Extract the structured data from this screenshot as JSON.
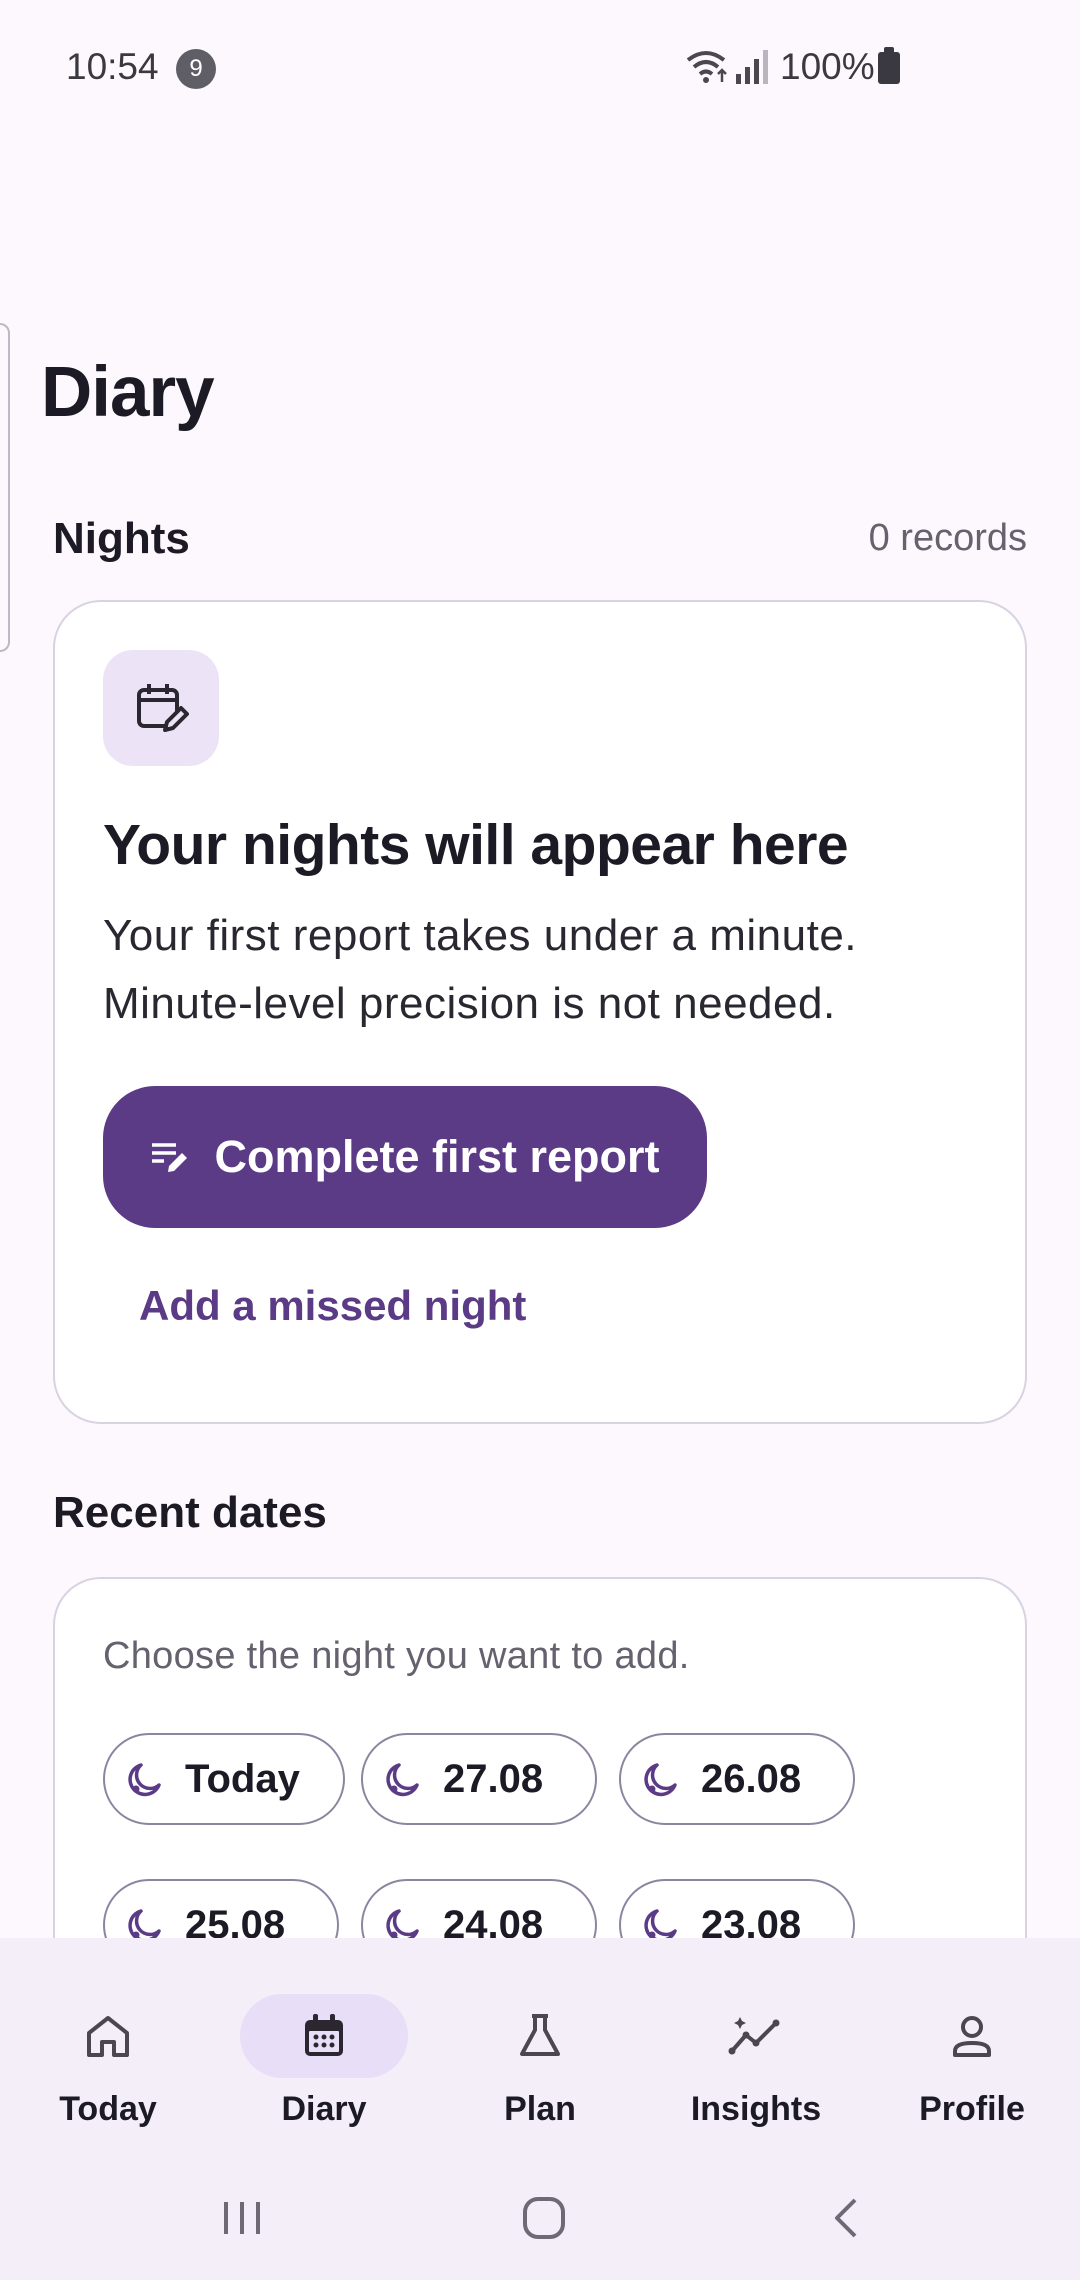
{
  "status_bar": {
    "time": "10:54",
    "notification_count": "9",
    "battery": "100%",
    "icons": [
      "wifi-icon",
      "signal-icon",
      "battery-icon"
    ]
  },
  "page": {
    "title": "Diary"
  },
  "nights": {
    "section_title": "Nights",
    "count": "0 records",
    "empty_state": {
      "icon": "calendar-edit-icon",
      "heading": "Your nights will appear here",
      "body": "Your first report takes under a minute. Minute-level precision is not needed.",
      "primary_button": "Complete first report",
      "primary_button_icon": "edit-note-icon",
      "secondary_button": "Add a missed night"
    }
  },
  "recent_dates": {
    "section_title": "Recent dates",
    "hint": "Choose the night you want to add.",
    "chip_icon": "moon-icon",
    "dates": [
      "Today",
      "27.08",
      "26.08",
      "25.08",
      "24.08",
      "23.08"
    ]
  },
  "bottom_nav": {
    "active": "Diary",
    "items": [
      {
        "label": "Today",
        "icon": "home-icon"
      },
      {
        "label": "Diary",
        "icon": "calendar-icon"
      },
      {
        "label": "Plan",
        "icon": "flask-icon"
      },
      {
        "label": "Insights",
        "icon": "insights-icon"
      },
      {
        "label": "Profile",
        "icon": "person-icon"
      }
    ]
  },
  "system_nav": [
    "recents-button",
    "home-button",
    "back-button"
  ],
  "colors": {
    "primary": "#5b3a86",
    "background": "#fcf8fd",
    "card_border": "#d9d2e3",
    "nav_background": "#f3eef8",
    "active_pill": "#e9def7"
  }
}
